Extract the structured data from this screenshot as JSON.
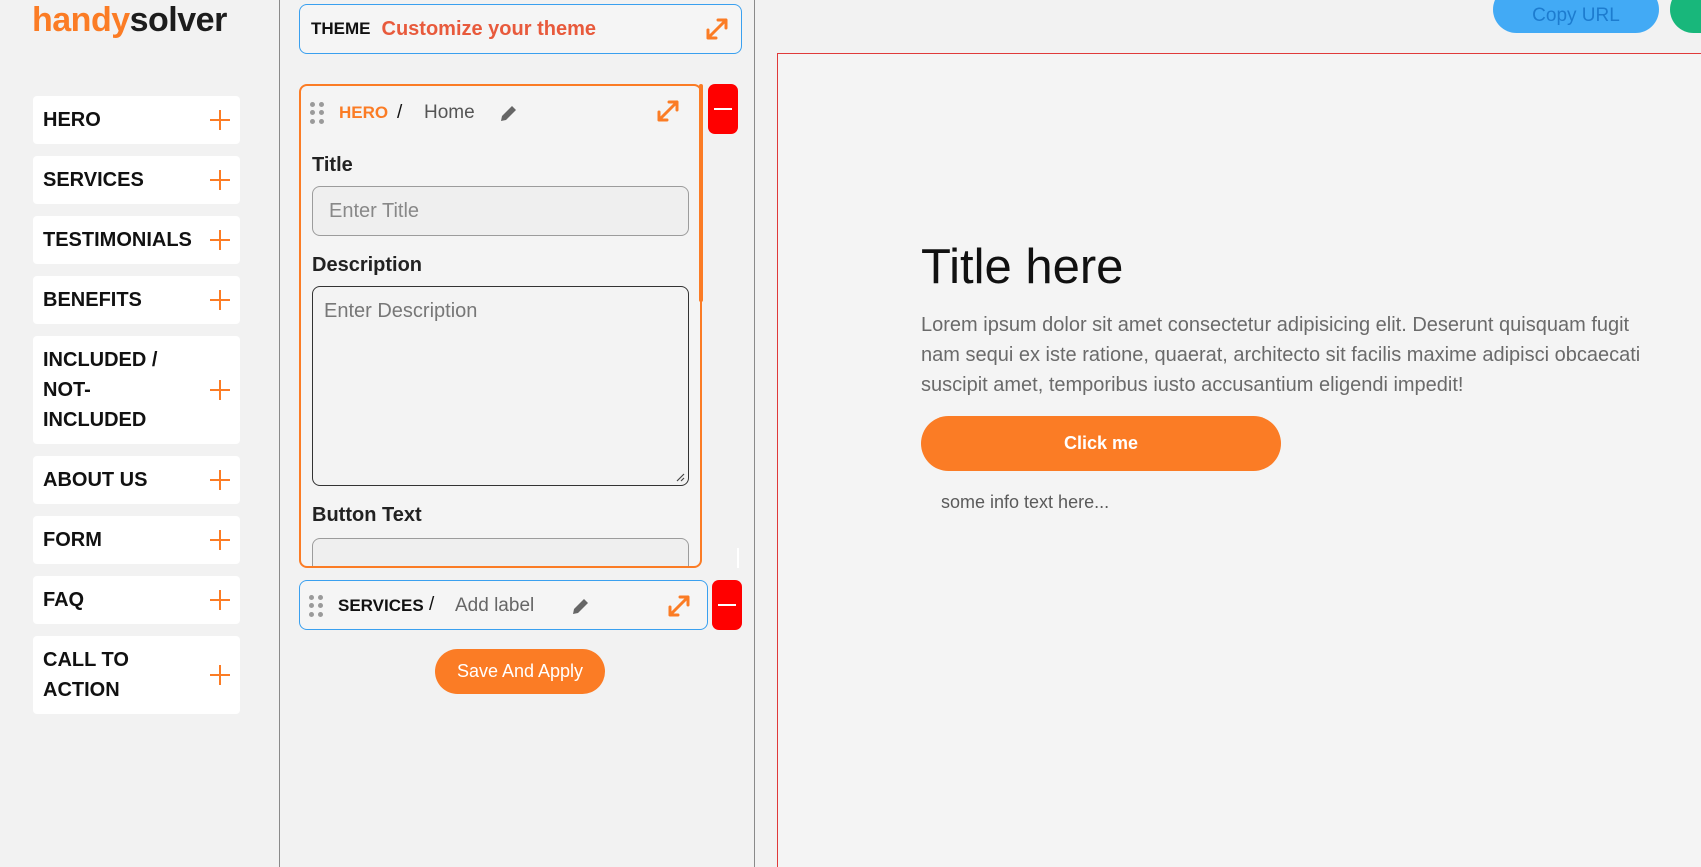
{
  "logo": {
    "part1": "handy",
    "part2": "solver"
  },
  "sections": [
    {
      "label": "HERO"
    },
    {
      "label": "SERVICES"
    },
    {
      "label": "TESTIMONIALS"
    },
    {
      "label": "BENEFITS"
    },
    {
      "label": "INCLUDED / NOT-INCLUDED"
    },
    {
      "label": "ABOUT US"
    },
    {
      "label": "FORM"
    },
    {
      "label": "FAQ"
    },
    {
      "label": "CALL TO ACTION"
    }
  ],
  "theme": {
    "label": "THEME",
    "link": "Customize your theme"
  },
  "hero": {
    "name": "HERO",
    "separator": "/",
    "label": "Home",
    "title_label": "Title",
    "title_placeholder": "Enter Title",
    "description_label": "Description",
    "description_placeholder": "Enter Description",
    "button_text_label": "Button Text"
  },
  "services": {
    "name": "SERVICES",
    "separator": "/",
    "label_placeholder": "Add label"
  },
  "save_button": "Save And Apply",
  "copy_url_button": "Copy URL",
  "preview": {
    "title": "Title here",
    "description": "Lorem ipsum dolor sit amet consectetur adipisicing elit. Deserunt quisquam fugit nam sequi ex iste ratione, quaerat, architecto sit facilis maxime adipisci obcaecati suscipit amet, temporibus iusto accusantium eligendi impedit!",
    "button": "Click me",
    "info": "some info text here..."
  },
  "colors": {
    "accent": "#fb7c25",
    "danger": "#ff0000",
    "link": "#e85a3c",
    "info_blue": "#3aa0ef",
    "green": "#18b77b"
  }
}
